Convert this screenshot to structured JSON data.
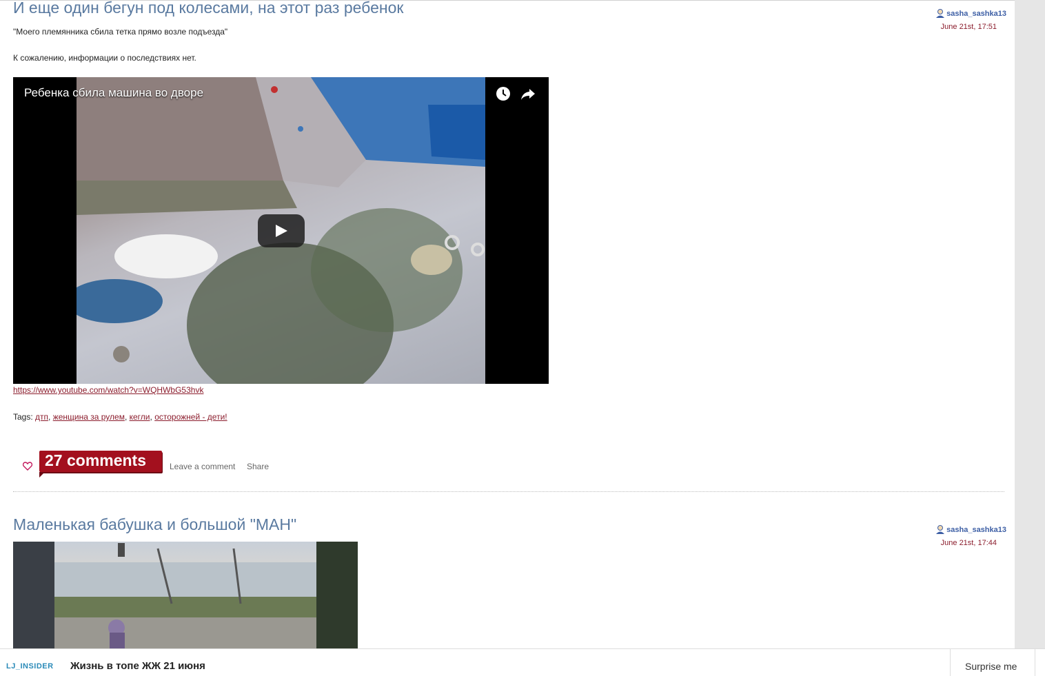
{
  "posts": [
    {
      "title": "И еще один бегун под колесами, на этот раз ребенок",
      "author": "sasha_sashka13",
      "date": "June 21st, 17:51",
      "quote": "\"Моего племянника сбила тетка прямо возле подъезда\"",
      "body": "К сожалению, информации о последствиях нет.",
      "video_title": "Ребенка сбила машина во дворе",
      "link": "https://www.youtube.com/watch?v=WQHWbG53hvk",
      "tags_label": "Tags:",
      "tags": [
        "дтп",
        "женщина за рулем",
        "кегли",
        "осторожней - дети!"
      ],
      "comments_label": "27 comments",
      "leave_comment": "Leave a comment",
      "share": "Share"
    },
    {
      "title": "Маленькая бабушка и большой \"МАН\"",
      "author": "sasha_sashka13",
      "date": "June 21st, 17:44"
    }
  ],
  "bottom_bar": {
    "brand": "LJ_INSIDER",
    "headline": "Жизнь в топе ЖЖ 21 июня",
    "surprise": "Surprise me"
  },
  "colors": {
    "title": "#5a7aa0",
    "link": "#8b1c2c",
    "comments_badge": "#a3101e",
    "author": "#3d5fa5",
    "brand": "#2a8ab8"
  }
}
